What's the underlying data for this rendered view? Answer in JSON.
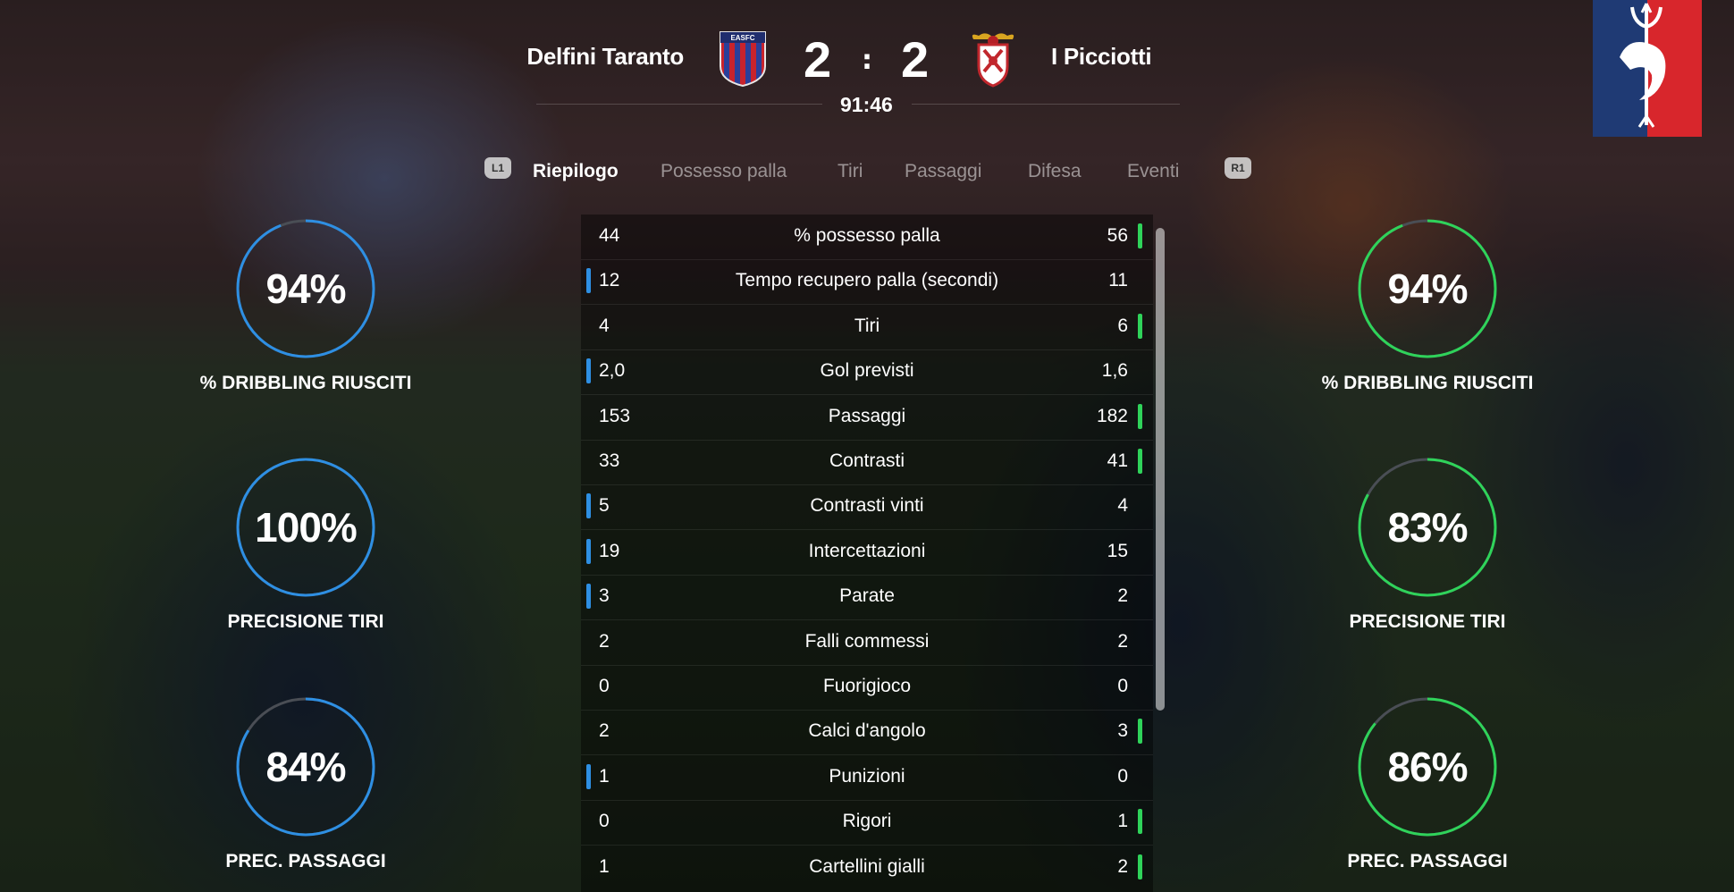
{
  "match": {
    "home_team": "Delfini Taranto",
    "away_team": "I Picciotti",
    "home_score": "2",
    "separator": ":",
    "away_score": "2",
    "clock": "91:46",
    "home_crest_text": "EASFC"
  },
  "tabs": {
    "left_hint": "L1",
    "right_hint": "R1",
    "items": [
      "Riepilogo",
      "Possesso palla",
      "Tiri",
      "Passaggi",
      "Difesa",
      "Eventi"
    ],
    "active": "Riepilogo"
  },
  "stats": [
    {
      "home": "44",
      "label": "% possesso palla",
      "away": "56",
      "leader": "away"
    },
    {
      "home": "12",
      "label": "Tempo recupero palla (secondi)",
      "away": "11",
      "leader": "home"
    },
    {
      "home": "4",
      "label": "Tiri",
      "away": "6",
      "leader": "away"
    },
    {
      "home": "2,0",
      "label": "Gol previsti",
      "away": "1,6",
      "leader": "home"
    },
    {
      "home": "153",
      "label": "Passaggi",
      "away": "182",
      "leader": "away"
    },
    {
      "home": "33",
      "label": "Contrasti",
      "away": "41",
      "leader": "away"
    },
    {
      "home": "5",
      "label": "Contrasti vinti",
      "away": "4",
      "leader": "home"
    },
    {
      "home": "19",
      "label": "Intercettazioni",
      "away": "15",
      "leader": "home"
    },
    {
      "home": "3",
      "label": "Parate",
      "away": "2",
      "leader": "home"
    },
    {
      "home": "2",
      "label": "Falli commessi",
      "away": "2",
      "leader": "none"
    },
    {
      "home": "0",
      "label": "Fuorigioco",
      "away": "0",
      "leader": "none"
    },
    {
      "home": "2",
      "label": "Calci d'angolo",
      "away": "3",
      "leader": "away"
    },
    {
      "home": "1",
      "label": "Punizioni",
      "away": "0",
      "leader": "home"
    },
    {
      "home": "0",
      "label": "Rigori",
      "away": "1",
      "leader": "away"
    },
    {
      "home": "1",
      "label": "Cartellini gialli",
      "away": "2",
      "leader": "away"
    }
  ],
  "home_rings": [
    {
      "value": "94%",
      "fraction": 0.94,
      "label": "% DRIBBLING RIUSCITI"
    },
    {
      "value": "100%",
      "fraction": 1.0,
      "label": "PRECISIONE TIRI"
    },
    {
      "value": "84%",
      "fraction": 0.84,
      "label": "PREC. PASSAGGI"
    }
  ],
  "away_rings": [
    {
      "value": "94%",
      "fraction": 0.94,
      "label": "% DRIBBLING RIUSCITI"
    },
    {
      "value": "83%",
      "fraction": 0.83,
      "label": "PRECISIONE TIRI"
    },
    {
      "value": "86%",
      "fraction": 0.86,
      "label": "PREC. PASSAGGI"
    }
  ],
  "colors": {
    "home_accent": "#2e8fe3",
    "away_accent": "#2fd35a",
    "ring_track": "#4a4e55",
    "crest_blue": "#1f3a74",
    "crest_red": "#d8262c"
  },
  "icons": {
    "home_crest": "shield-crest-icon",
    "away_crest": "eagle-crest-icon",
    "club_logo": "trident-dolphin-logo"
  }
}
